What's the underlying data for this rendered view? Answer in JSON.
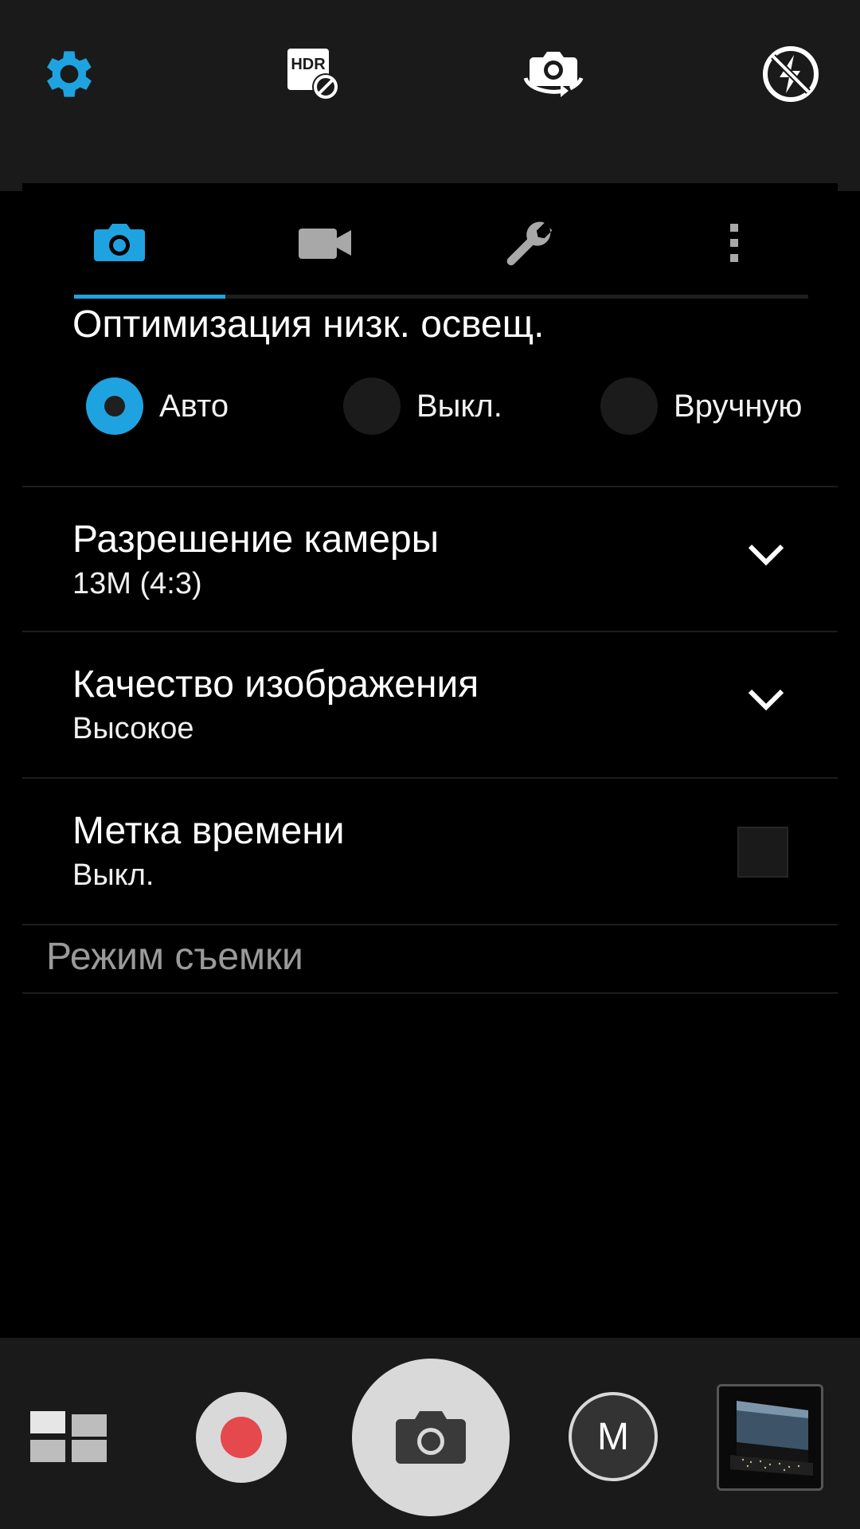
{
  "toolbar": {
    "icons": [
      "gear-icon",
      "hdr-off-icon",
      "switch-camera-icon",
      "flash-off-icon"
    ]
  },
  "tabs": [
    {
      "icon": "camera-icon",
      "selected": true
    },
    {
      "icon": "video-camera-icon",
      "selected": false
    },
    {
      "icon": "wrench-icon",
      "selected": false
    },
    {
      "icon": "more-vertical-icon",
      "selected": false
    }
  ],
  "low_light": {
    "title": "Оптимизация низк. освещ.",
    "options": [
      "Авто",
      "Выкл.",
      "Вручную"
    ],
    "selected": "Авто"
  },
  "settings": [
    {
      "title": "Разрешение камеры",
      "value": "13M (4:3)",
      "control": "dropdown"
    },
    {
      "title": "Качество изображения",
      "value": "Высокое",
      "control": "dropdown"
    },
    {
      "title": "Метка времени",
      "value": "Выкл.",
      "control": "checkbox",
      "checked": false
    }
  ],
  "shooting_mode_header": "Режим съемки",
  "bottom": {
    "mode_label": "M",
    "record_color": "#e5484d"
  },
  "colors": {
    "accent": "#1fa3e0"
  }
}
